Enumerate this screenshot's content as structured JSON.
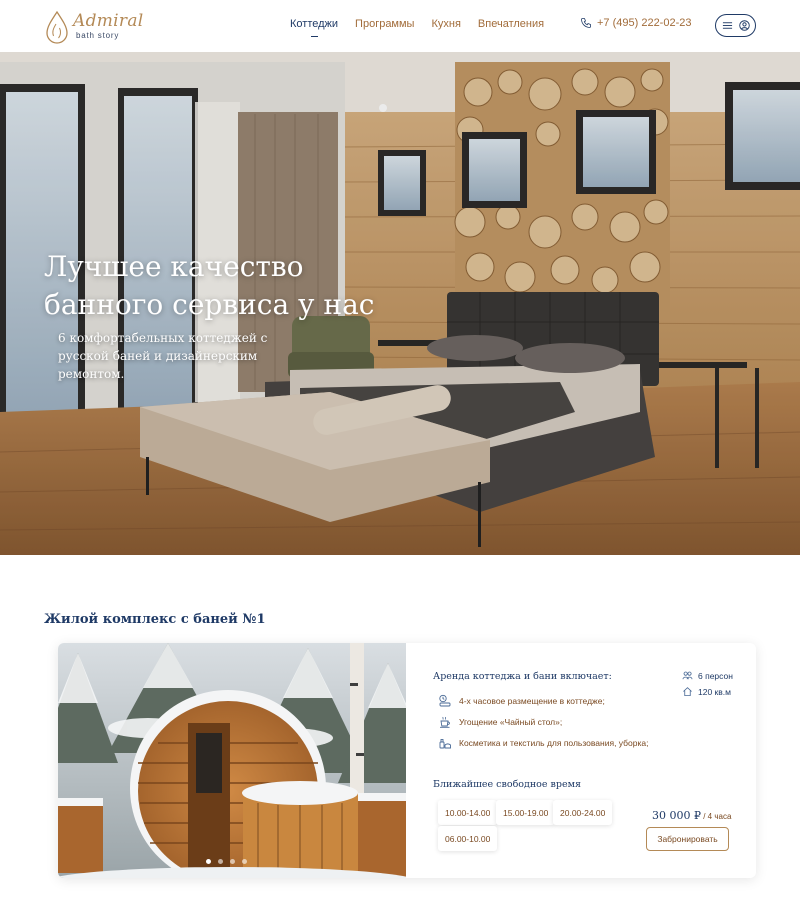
{
  "brand": {
    "name": "Admiral",
    "tagline": "bath story",
    "accent": "#b48a57",
    "navy": "#1f3a66"
  },
  "nav": {
    "items": [
      {
        "label": "Коттеджи",
        "active": true
      },
      {
        "label": "Программы",
        "active": false
      },
      {
        "label": "Кухня",
        "active": false
      },
      {
        "label": "Впечатления",
        "active": false
      }
    ]
  },
  "header": {
    "phone": "+7 (495) 222-02-23",
    "menu_icon": "hamburger-icon",
    "account_icon": "user-icon"
  },
  "hero": {
    "title": "Лучшее качество банного сервиса у нас",
    "subtitle": "6 комфортабельных коттеджей с русской баней и дизайнерским ремонтом."
  },
  "listing": {
    "section_title": "Жилой комплекс с баней №1",
    "includes_title": "Аренда коттеджа и бани включает:",
    "features": [
      {
        "icon": "clock-bed-icon",
        "text": "4-х часовое размещение в коттедже;"
      },
      {
        "icon": "tea-icon",
        "text": "Угощение «Чайный стол»;"
      },
      {
        "icon": "cosmetics-icon",
        "text": "Косметика и текстиль для пользования, уборка;"
      }
    ],
    "stats": [
      {
        "icon": "people-icon",
        "text": "6 персон"
      },
      {
        "icon": "house-icon",
        "text": "120 кв.м"
      }
    ],
    "slots_title": "Ближайшее свободное время",
    "slots": [
      "10.00-14.00",
      "15.00-19.00",
      "20.00-24.00",
      "06.00-10.00"
    ],
    "price": "30 000 ₽",
    "price_unit": " / 4 часа",
    "book_label": "Забронировать",
    "slider": {
      "count": 4,
      "active": 0
    }
  }
}
